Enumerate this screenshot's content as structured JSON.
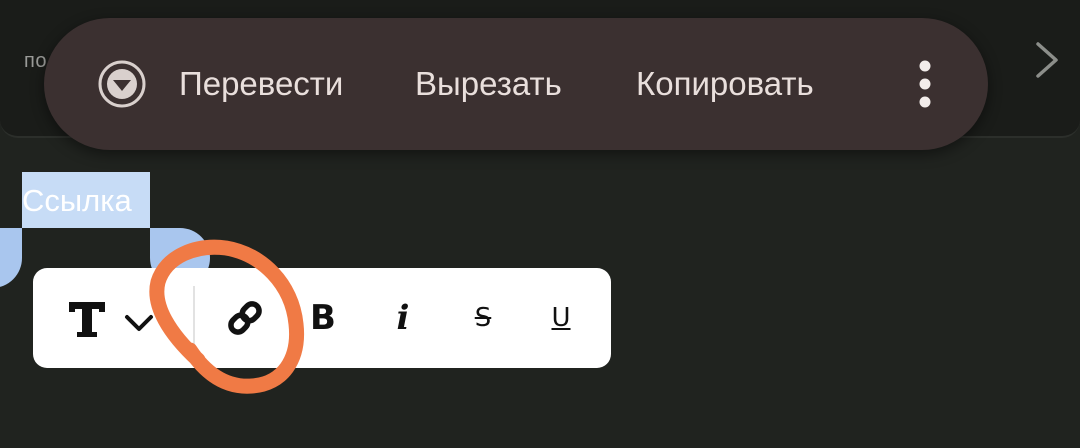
{
  "background": {
    "suggestion_text": "по"
  },
  "context_menu": {
    "translate_label": "Перевести",
    "cut_label": "Вырезать",
    "copy_label": "Копировать"
  },
  "editor": {
    "selected_text": "Ссылка"
  },
  "format_toolbar": {
    "buttons": [
      {
        "name": "text-style",
        "icon": "text-format-icon"
      },
      {
        "name": "link",
        "icon": "link-icon"
      },
      {
        "name": "bold",
        "label": "B"
      },
      {
        "name": "italic",
        "label": "i"
      },
      {
        "name": "strikethrough",
        "label": "S"
      },
      {
        "name": "underline",
        "label": "U"
      }
    ]
  },
  "colors": {
    "background": "#20231f",
    "menu_background": "#3b3030",
    "menu_text": "#e9dfdc",
    "selection": "#c7dcf6",
    "selection_handle": "#a9c6ee",
    "toolbar_background": "#ffffff",
    "annotation": "#f07a45"
  }
}
